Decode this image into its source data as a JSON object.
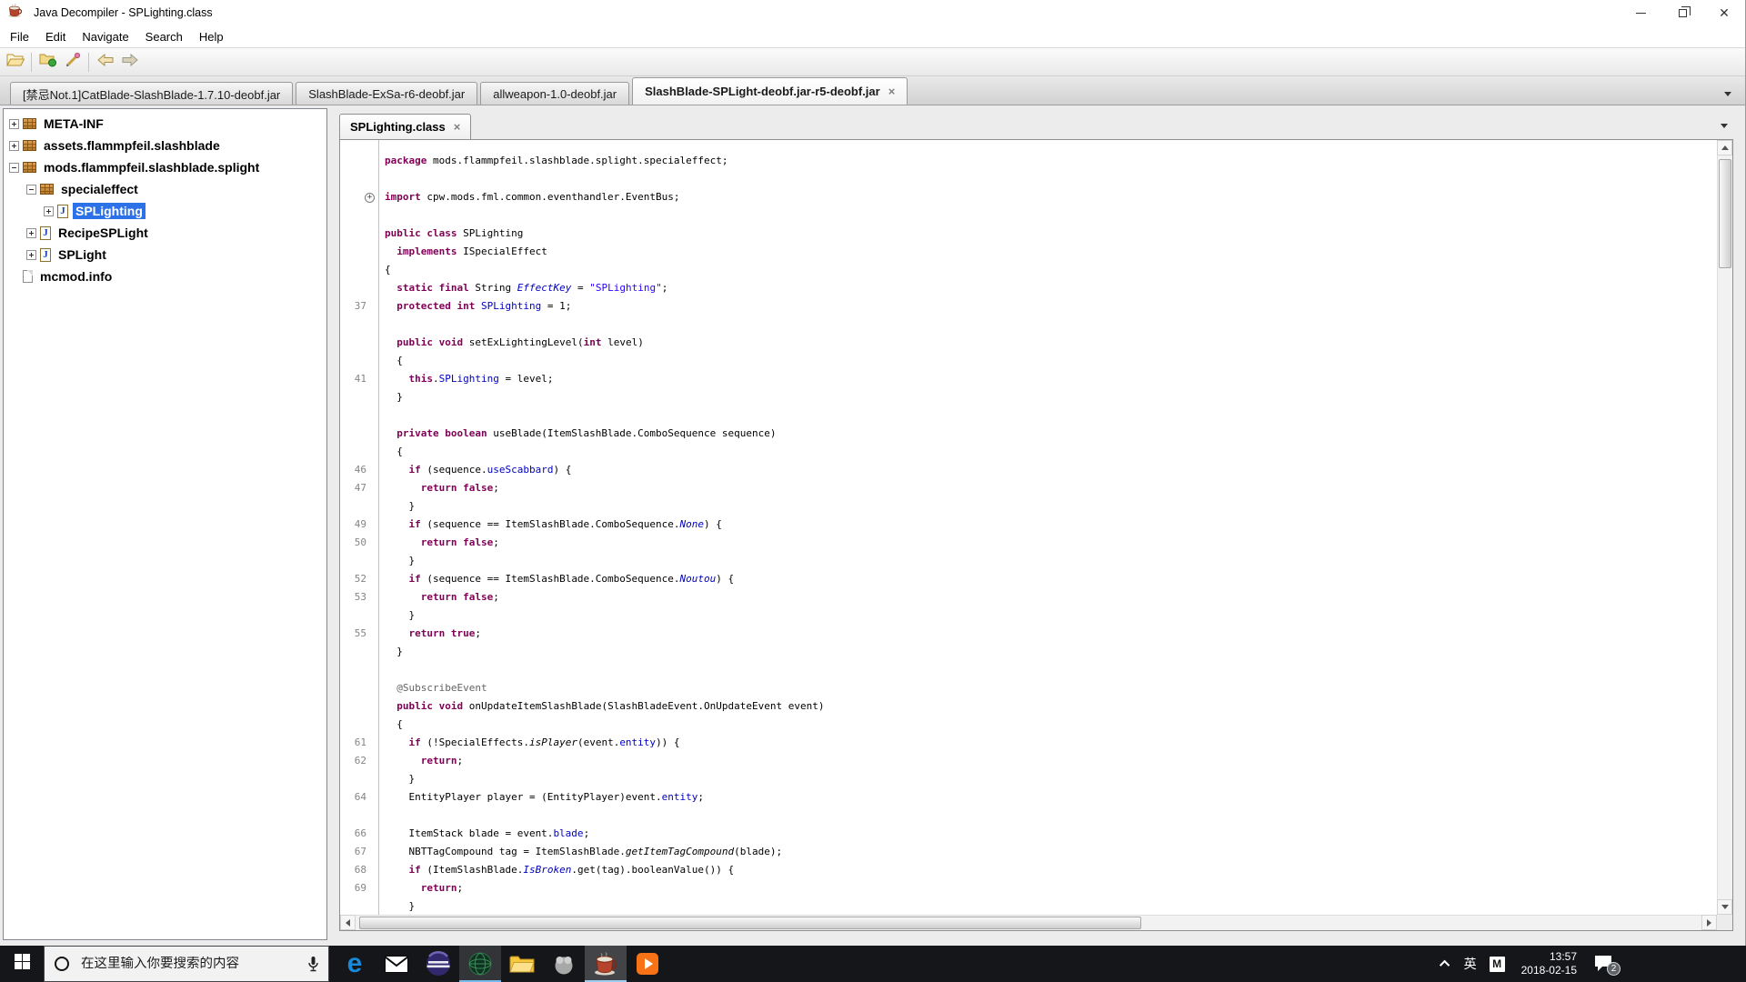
{
  "ui": {
    "close_glyph": "×",
    "fold_glyph": "+"
  },
  "colors": {
    "selection": "#2d71e8",
    "keyword": "#7f0055",
    "string": "#2a00ff",
    "field": "#0000c0",
    "annotation": "#646464",
    "line_number": "#858585",
    "taskbar": "#14161a",
    "edge_blue": "#1789d8"
  },
  "titlebar": {
    "title": "Java Decompiler - SPLighting.class"
  },
  "menubar": {
    "items": [
      "File",
      "Edit",
      "Navigate",
      "Search",
      "Help"
    ]
  },
  "toolbar": {
    "icons": [
      "open-folder-icon",
      "open-type-icon",
      "search-pen-icon",
      "back-arrow-icon",
      "forward-arrow-icon"
    ]
  },
  "jar_tabs": {
    "tabs": [
      {
        "label": "[禁忌Not.1]CatBlade-SlashBlade-1.7.10-deobf.jar",
        "active": false,
        "closable": false
      },
      {
        "label": "SlashBlade-ExSa-r6-deobf.jar",
        "active": false,
        "closable": false
      },
      {
        "label": "allweapon-1.0-deobf.jar",
        "active": false,
        "closable": false
      },
      {
        "label": "SlashBlade-SPLight-deobf.jar-r5-deobf.jar",
        "active": true,
        "closable": true
      }
    ]
  },
  "tree": {
    "items": [
      {
        "depth": 0,
        "toggle": "plus",
        "icon": "package",
        "label": "META-INF",
        "selected": false
      },
      {
        "depth": 0,
        "toggle": "plus",
        "icon": "package",
        "label": "assets.flammpfeil.slashblade",
        "selected": false
      },
      {
        "depth": 0,
        "toggle": "minus",
        "icon": "package",
        "label": "mods.flammpfeil.slashblade.splight",
        "selected": false
      },
      {
        "depth": 1,
        "toggle": "minus",
        "icon": "package",
        "label": "specialeffect",
        "selected": false
      },
      {
        "depth": 2,
        "toggle": "plus",
        "icon": "class",
        "label": "SPLighting",
        "selected": true
      },
      {
        "depth": 1,
        "toggle": "plus",
        "icon": "class",
        "label": "RecipeSPLight",
        "selected": false
      },
      {
        "depth": 1,
        "toggle": "plus",
        "icon": "class",
        "label": "SPLight",
        "selected": false
      },
      {
        "depth": 0,
        "toggle": null,
        "icon": "file",
        "label": "mcmod.info",
        "selected": false
      }
    ]
  },
  "source_tab": {
    "label": "SPLighting.class",
    "closable": true
  },
  "code": {
    "lines": [
      {
        "n": "",
        "s": [
          [
            "kw",
            "package"
          ],
          [
            "pl",
            " mods.flammpfeil.slashblade.splight.specialeffect;"
          ]
        ]
      },
      {
        "n": "",
        "s": []
      },
      {
        "n": "",
        "fold": true,
        "s": [
          [
            "kw",
            "import"
          ],
          [
            "pl",
            " cpw.mods.fml.common.eventhandler.EventBus;"
          ]
        ]
      },
      {
        "n": "",
        "s": []
      },
      {
        "n": "",
        "s": [
          [
            "kw",
            "public"
          ],
          [
            "pl",
            " "
          ],
          [
            "kw",
            "class"
          ],
          [
            "pl",
            " SPLighting"
          ]
        ]
      },
      {
        "n": "",
        "s": [
          [
            "pl",
            "  "
          ],
          [
            "kw",
            "implements"
          ],
          [
            "pl",
            " ISpecialEffect"
          ]
        ]
      },
      {
        "n": "",
        "s": [
          [
            "pl",
            "{"
          ]
        ]
      },
      {
        "n": "",
        "s": [
          [
            "pl",
            "  "
          ],
          [
            "kw",
            "static"
          ],
          [
            "pl",
            " "
          ],
          [
            "kw",
            "final"
          ],
          [
            "pl",
            " String "
          ],
          [
            "sf",
            "EffectKey"
          ],
          [
            "pl",
            " = "
          ],
          [
            "st",
            "\"SPLighting\""
          ],
          [
            "pl",
            ";"
          ]
        ]
      },
      {
        "n": "37",
        "s": [
          [
            "pl",
            "  "
          ],
          [
            "kw",
            "protected"
          ],
          [
            "pl",
            " "
          ],
          [
            "kw",
            "int"
          ],
          [
            "pl",
            " "
          ],
          [
            "fd",
            "SPLighting"
          ],
          [
            "pl",
            " = 1;"
          ]
        ]
      },
      {
        "n": "",
        "s": []
      },
      {
        "n": "",
        "s": [
          [
            "pl",
            "  "
          ],
          [
            "kw",
            "public"
          ],
          [
            "pl",
            " "
          ],
          [
            "kw",
            "void"
          ],
          [
            "pl",
            " setExLightingLevel("
          ],
          [
            "kw",
            "int"
          ],
          [
            "pl",
            " level)"
          ]
        ]
      },
      {
        "n": "",
        "s": [
          [
            "pl",
            "  {"
          ]
        ]
      },
      {
        "n": "41",
        "s": [
          [
            "pl",
            "    "
          ],
          [
            "kw",
            "this"
          ],
          [
            "pl",
            "."
          ],
          [
            "fd",
            "SPLighting"
          ],
          [
            "pl",
            " = level;"
          ]
        ]
      },
      {
        "n": "",
        "s": [
          [
            "pl",
            "  }"
          ]
        ]
      },
      {
        "n": "",
        "s": []
      },
      {
        "n": "",
        "s": [
          [
            "pl",
            "  "
          ],
          [
            "kw",
            "private"
          ],
          [
            "pl",
            " "
          ],
          [
            "kw",
            "boolean"
          ],
          [
            "pl",
            " useBlade(ItemSlashBlade.ComboSequence sequence)"
          ]
        ]
      },
      {
        "n": "",
        "s": [
          [
            "pl",
            "  {"
          ]
        ]
      },
      {
        "n": "46",
        "s": [
          [
            "pl",
            "    "
          ],
          [
            "kw",
            "if"
          ],
          [
            "pl",
            " (sequence."
          ],
          [
            "fd",
            "useScabbard"
          ],
          [
            "pl",
            ") {"
          ]
        ]
      },
      {
        "n": "47",
        "s": [
          [
            "pl",
            "      "
          ],
          [
            "kw",
            "return"
          ],
          [
            "pl",
            " "
          ],
          [
            "kw",
            "false"
          ],
          [
            "pl",
            ";"
          ]
        ]
      },
      {
        "n": "",
        "s": [
          [
            "pl",
            "    }"
          ]
        ]
      },
      {
        "n": "49",
        "s": [
          [
            "pl",
            "    "
          ],
          [
            "kw",
            "if"
          ],
          [
            "pl",
            " (sequence == ItemSlashBlade.ComboSequence."
          ],
          [
            "sf",
            "None"
          ],
          [
            "pl",
            ") {"
          ]
        ]
      },
      {
        "n": "50",
        "s": [
          [
            "pl",
            "      "
          ],
          [
            "kw",
            "return"
          ],
          [
            "pl",
            " "
          ],
          [
            "kw",
            "false"
          ],
          [
            "pl",
            ";"
          ]
        ]
      },
      {
        "n": "",
        "s": [
          [
            "pl",
            "    }"
          ]
        ]
      },
      {
        "n": "52",
        "s": [
          [
            "pl",
            "    "
          ],
          [
            "kw",
            "if"
          ],
          [
            "pl",
            " (sequence == ItemSlashBlade.ComboSequence."
          ],
          [
            "sf",
            "Noutou"
          ],
          [
            "pl",
            ") {"
          ]
        ]
      },
      {
        "n": "53",
        "s": [
          [
            "pl",
            "      "
          ],
          [
            "kw",
            "return"
          ],
          [
            "pl",
            " "
          ],
          [
            "kw",
            "false"
          ],
          [
            "pl",
            ";"
          ]
        ]
      },
      {
        "n": "",
        "s": [
          [
            "pl",
            "    }"
          ]
        ]
      },
      {
        "n": "55",
        "s": [
          [
            "pl",
            "    "
          ],
          [
            "kw",
            "return"
          ],
          [
            "pl",
            " "
          ],
          [
            "kw",
            "true"
          ],
          [
            "pl",
            ";"
          ]
        ]
      },
      {
        "n": "",
        "s": [
          [
            "pl",
            "  }"
          ]
        ]
      },
      {
        "n": "",
        "s": []
      },
      {
        "n": "",
        "s": [
          [
            "pl",
            "  "
          ],
          [
            "an",
            "@SubscribeEvent"
          ]
        ]
      },
      {
        "n": "",
        "s": [
          [
            "pl",
            "  "
          ],
          [
            "kw",
            "public"
          ],
          [
            "pl",
            " "
          ],
          [
            "kw",
            "void"
          ],
          [
            "pl",
            " onUpdateItemSlashBlade(SlashBladeEvent.OnUpdateEvent event)"
          ]
        ]
      },
      {
        "n": "",
        "s": [
          [
            "pl",
            "  {"
          ]
        ]
      },
      {
        "n": "61",
        "s": [
          [
            "pl",
            "    "
          ],
          [
            "kw",
            "if"
          ],
          [
            "pl",
            " (!SpecialEffects."
          ],
          [
            "sm",
            "isPlayer"
          ],
          [
            "pl",
            "(event."
          ],
          [
            "fd",
            "entity"
          ],
          [
            "pl",
            ")) {"
          ]
        ]
      },
      {
        "n": "62",
        "s": [
          [
            "pl",
            "      "
          ],
          [
            "kw",
            "return"
          ],
          [
            "pl",
            ";"
          ]
        ]
      },
      {
        "n": "",
        "s": [
          [
            "pl",
            "    }"
          ]
        ]
      },
      {
        "n": "64",
        "s": [
          [
            "pl",
            "    EntityPlayer player = (EntityPlayer)event."
          ],
          [
            "fd",
            "entity"
          ],
          [
            "pl",
            ";"
          ]
        ]
      },
      {
        "n": "",
        "s": []
      },
      {
        "n": "66",
        "s": [
          [
            "pl",
            "    ItemStack blade = event."
          ],
          [
            "fd",
            "blade"
          ],
          [
            "pl",
            ";"
          ]
        ]
      },
      {
        "n": "67",
        "s": [
          [
            "pl",
            "    NBTTagCompound tag = ItemSlashBlade."
          ],
          [
            "sm",
            "getItemTagCompound"
          ],
          [
            "pl",
            "(blade);"
          ]
        ]
      },
      {
        "n": "68",
        "s": [
          [
            "pl",
            "    "
          ],
          [
            "kw",
            "if"
          ],
          [
            "pl",
            " (ItemSlashBlade."
          ],
          [
            "sf",
            "IsBroken"
          ],
          [
            "pl",
            ".get(tag).booleanValue()) {"
          ]
        ]
      },
      {
        "n": "69",
        "s": [
          [
            "pl",
            "      "
          ],
          [
            "kw",
            "return"
          ],
          [
            "pl",
            ";"
          ]
        ]
      },
      {
        "n": "",
        "s": [
          [
            "pl",
            "    }"
          ]
        ]
      }
    ]
  },
  "taskbar": {
    "search_placeholder": "在这里输入你要搜索的内容",
    "apps": [
      {
        "icon": "edge-icon"
      },
      {
        "icon": "mail-icon"
      },
      {
        "icon": "eclipse-icon"
      },
      {
        "icon": "globe-browser-icon",
        "highlighted": true
      },
      {
        "icon": "file-explorer-icon"
      },
      {
        "icon": "gray-app-icon"
      },
      {
        "icon": "jd-gui-icon",
        "highlighted": true,
        "active": true
      },
      {
        "icon": "media-player-icon"
      }
    ],
    "tray": {
      "language": "英",
      "ime_mode": "M",
      "time": "13:57",
      "date": "2018-02-15",
      "notification_count": "2"
    }
  }
}
